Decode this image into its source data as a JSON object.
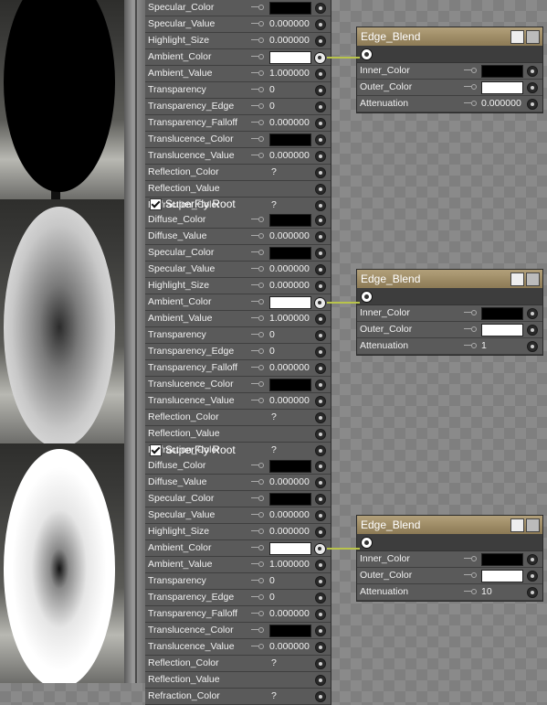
{
  "groups": [
    {
      "root_title": "",
      "rows": [
        {
          "label": "Specular_Color",
          "type": "swatch",
          "color": "#000000"
        },
        {
          "label": "Specular_Value",
          "type": "value",
          "value": "0.000000"
        },
        {
          "label": "Highlight_Size",
          "type": "value",
          "value": "0.000000"
        },
        {
          "label": "Ambient_Color",
          "type": "swatch",
          "color": "#ffffff",
          "linked": true
        },
        {
          "label": "Ambient_Value",
          "type": "value",
          "value": "1.000000"
        },
        {
          "label": "Transparency",
          "type": "value",
          "value": "0"
        },
        {
          "label": "Transparency_Edge",
          "type": "value",
          "value": "0"
        },
        {
          "label": "Transparency_Falloff",
          "type": "value",
          "value": "0.000000"
        },
        {
          "label": "Translucence_Color",
          "type": "swatch",
          "color": "#000000"
        },
        {
          "label": "Translucence_Value",
          "type": "value",
          "value": "0.000000"
        },
        {
          "label": "Reflection_Color",
          "type": "q",
          "value": "?"
        },
        {
          "label": "Reflection_Value",
          "type": "none"
        },
        {
          "label": "Refraction_Color",
          "type": "q",
          "value": "?"
        }
      ],
      "blend": {
        "title": "Edge_Blend",
        "rows": [
          {
            "label": "Inner_Color",
            "type": "swatch",
            "color": "#000000"
          },
          {
            "label": "Outer_Color",
            "type": "swatch",
            "color": "#ffffff"
          },
          {
            "label": "Attenuation",
            "type": "value",
            "value": "0.000000"
          }
        ]
      }
    },
    {
      "root_title": "SuperFly Root",
      "rows": [
        {
          "label": "Diffuse_Color",
          "type": "swatch",
          "color": "#000000"
        },
        {
          "label": "Diffuse_Value",
          "type": "value",
          "value": "0.000000"
        },
        {
          "label": "Specular_Color",
          "type": "swatch",
          "color": "#000000"
        },
        {
          "label": "Specular_Value",
          "type": "value",
          "value": "0.000000"
        },
        {
          "label": "Highlight_Size",
          "type": "value",
          "value": "0.000000"
        },
        {
          "label": "Ambient_Color",
          "type": "swatch",
          "color": "#ffffff",
          "linked": true
        },
        {
          "label": "Ambient_Value",
          "type": "value",
          "value": "1.000000"
        },
        {
          "label": "Transparency",
          "type": "value",
          "value": "0"
        },
        {
          "label": "Transparency_Edge",
          "type": "value",
          "value": "0"
        },
        {
          "label": "Transparency_Falloff",
          "type": "value",
          "value": "0.000000"
        },
        {
          "label": "Translucence_Color",
          "type": "swatch",
          "color": "#000000"
        },
        {
          "label": "Translucence_Value",
          "type": "value",
          "value": "0.000000"
        },
        {
          "label": "Reflection_Color",
          "type": "q",
          "value": "?"
        },
        {
          "label": "Reflection_Value",
          "type": "none"
        },
        {
          "label": "Refraction_Color",
          "type": "q",
          "value": "?"
        }
      ],
      "blend": {
        "title": "Edge_Blend",
        "rows": [
          {
            "label": "Inner_Color",
            "type": "swatch",
            "color": "#000000"
          },
          {
            "label": "Outer_Color",
            "type": "swatch",
            "color": "#ffffff"
          },
          {
            "label": "Attenuation",
            "type": "value",
            "value": "1"
          }
        ]
      }
    },
    {
      "root_title": "SuperFly Root",
      "rows": [
        {
          "label": "Diffuse_Color",
          "type": "swatch",
          "color": "#000000"
        },
        {
          "label": "Diffuse_Value",
          "type": "value",
          "value": "0.000000"
        },
        {
          "label": "Specular_Color",
          "type": "swatch",
          "color": "#000000"
        },
        {
          "label": "Specular_Value",
          "type": "value",
          "value": "0.000000"
        },
        {
          "label": "Highlight_Size",
          "type": "value",
          "value": "0.000000"
        },
        {
          "label": "Ambient_Color",
          "type": "swatch",
          "color": "#ffffff",
          "linked": true
        },
        {
          "label": "Ambient_Value",
          "type": "value",
          "value": "1.000000"
        },
        {
          "label": "Transparency",
          "type": "value",
          "value": "0"
        },
        {
          "label": "Transparency_Edge",
          "type": "value",
          "value": "0"
        },
        {
          "label": "Transparency_Falloff",
          "type": "value",
          "value": "0.000000"
        },
        {
          "label": "Translucence_Color",
          "type": "swatch",
          "color": "#000000"
        },
        {
          "label": "Translucence_Value",
          "type": "value",
          "value": "0.000000"
        },
        {
          "label": "Reflection_Color",
          "type": "q",
          "value": "?"
        },
        {
          "label": "Reflection_Value",
          "type": "none"
        },
        {
          "label": "Refraction_Color",
          "type": "q",
          "value": "?"
        }
      ],
      "blend": {
        "title": "Edge_Blend",
        "rows": [
          {
            "label": "Inner_Color",
            "type": "swatch",
            "color": "#000000"
          },
          {
            "label": "Outer_Color",
            "type": "swatch",
            "color": "#ffffff"
          },
          {
            "label": "Attenuation",
            "type": "value",
            "value": "10"
          }
        ]
      }
    }
  ],
  "colors": {
    "link": "#b9c44a",
    "title_bar": "#a8956d"
  }
}
